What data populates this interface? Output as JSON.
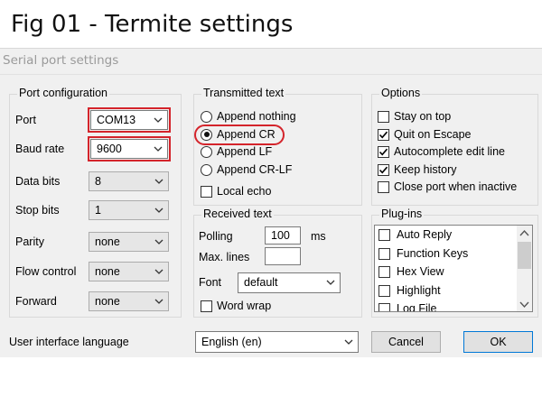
{
  "figure": {
    "title": "Fig 01 - Termite settings"
  },
  "window": {
    "title": "Serial port settings"
  },
  "port_config": {
    "label": "Port configuration",
    "rows": [
      {
        "label": "Port",
        "value": "COM13"
      },
      {
        "label": "Baud rate",
        "value": "9600"
      },
      {
        "label": "Data bits",
        "value": "8"
      },
      {
        "label": "Stop bits",
        "value": "1"
      },
      {
        "label": "Parity",
        "value": "none"
      },
      {
        "label": "Flow control",
        "value": "none"
      },
      {
        "label": "Forward",
        "value": "none"
      }
    ]
  },
  "transmitted": {
    "label": "Transmitted text",
    "options": [
      "Append nothing",
      "Append CR",
      "Append LF",
      "Append CR-LF"
    ],
    "selected": "Append CR",
    "local_echo": {
      "label": "Local echo",
      "checked": false
    }
  },
  "received": {
    "label": "Received text",
    "polling_label": "Polling",
    "polling_value": "100",
    "polling_unit": "ms",
    "max_lines_label": "Max. lines",
    "max_lines_value": "",
    "font_label": "Font",
    "font_value": "default",
    "word_wrap": {
      "label": "Word wrap",
      "checked": false
    }
  },
  "options": {
    "label": "Options",
    "items": [
      {
        "label": "Stay on top",
        "checked": false
      },
      {
        "label": "Quit on Escape",
        "checked": true
      },
      {
        "label": "Autocomplete edit line",
        "checked": true
      },
      {
        "label": "Keep history",
        "checked": true
      },
      {
        "label": "Close port when inactive",
        "checked": false
      }
    ]
  },
  "plugins": {
    "label": "Plug-ins",
    "items": [
      {
        "label": "Auto Reply",
        "checked": false
      },
      {
        "label": "Function Keys",
        "checked": false
      },
      {
        "label": "Hex View",
        "checked": false
      },
      {
        "label": "Highlight",
        "checked": false
      },
      {
        "label": "Log File",
        "checked": false
      }
    ]
  },
  "footer": {
    "language_label": "User interface language",
    "language_value": "English (en)",
    "cancel_label": "Cancel",
    "ok_label": "OK"
  },
  "colors": {
    "highlight": "#d4242b",
    "window_bg": "#f0f0f0",
    "check": "#000000"
  },
  "icons": {
    "dropdown": "chevron-down-icon",
    "check": "checkmark-icon"
  }
}
